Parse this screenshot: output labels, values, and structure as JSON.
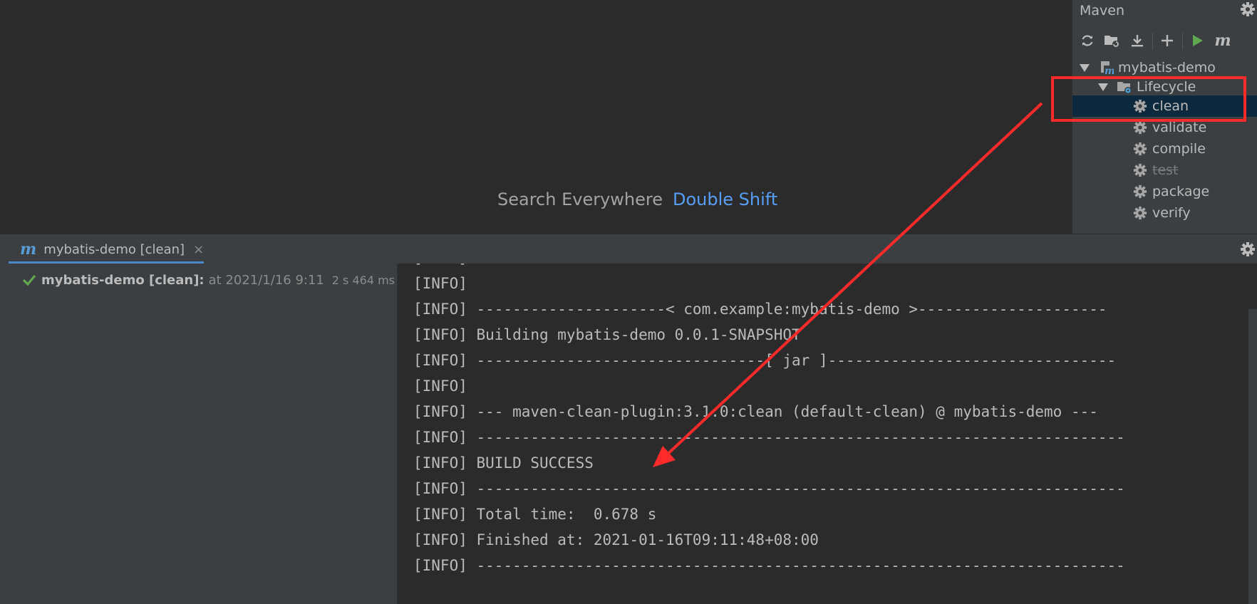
{
  "editor": {
    "search_label": "Search Everywhere",
    "search_shortcut": "Double Shift"
  },
  "maven": {
    "title": "Maven",
    "toolbar": [
      {
        "name": "reload-icon"
      },
      {
        "name": "folder-reload-icon"
      },
      {
        "name": "download-icon"
      },
      {
        "name": "plus-icon"
      },
      {
        "name": "run-icon"
      },
      {
        "name": "maven-m-icon"
      }
    ],
    "project": "mybatis-demo",
    "lifecycle": "Lifecycle",
    "phases": [
      "clean",
      "validate",
      "compile",
      "test",
      "package",
      "verify"
    ],
    "selected_phase": "clean",
    "skipped_phase": "test"
  },
  "run": {
    "tab_label": "mybatis-demo [clean]",
    "tab_close": "×",
    "item_name": "mybatis-demo [clean]:",
    "item_time": "at 2021/1/16 9:11",
    "item_duration": "2 s 464 ms",
    "console_lines": [
      "[INFO] --------------------------------",
      "[INFO]",
      "[INFO] ---------------------< com.example:mybatis-demo >---------------------",
      "[INFO] Building mybatis-demo 0.0.1-SNAPSHOT",
      "[INFO] --------------------------------[ jar ]--------------------------------",
      "[INFO]",
      "[INFO] --- maven-clean-plugin:3.1.0:clean (default-clean) @ mybatis-demo ---",
      "[INFO] ------------------------------------------------------------------------",
      "[INFO] BUILD SUCCESS",
      "[INFO] ------------------------------------------------------------------------",
      "[INFO] Total time:  0.678 s",
      "[INFO] Finished at: 2021-01-16T09:11:48+08:00",
      "[INFO] ------------------------------------------------------------------------"
    ]
  },
  "colors": {
    "annotation": "#ff2a2a",
    "accent": "#4a88c7",
    "success": "#5fa84f"
  }
}
